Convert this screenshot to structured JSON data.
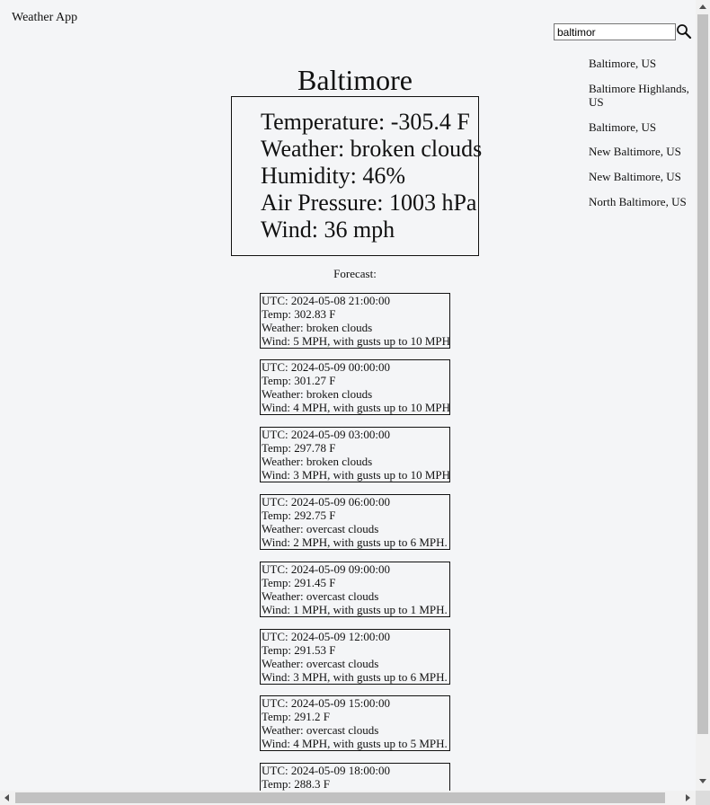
{
  "app": {
    "title": "Weather App"
  },
  "search": {
    "value": "baltimor",
    "icon": "search-icon"
  },
  "suggestions": [
    "Baltimore, US",
    "Baltimore Highlands, US",
    "Baltimore, US",
    "New Baltimore, US",
    "New Baltimore, US",
    "North Baltimore, US"
  ],
  "current": {
    "city": "Baltimore",
    "temperature": "Temperature: -305.4 F",
    "weather": "Weather: broken clouds",
    "humidity": "Humidity: 46%",
    "pressure": "Air Pressure: 1003 hPa",
    "wind": "Wind: 36 mph"
  },
  "forecast": {
    "label": "Forecast:",
    "items": [
      {
        "time": "UTC: 2024-05-08 21:00:00",
        "temp": "Temp: 302.83 F",
        "weather": "Weather: broken clouds",
        "wind": "Wind: 5 MPH, with gusts up to 10 MPH."
      },
      {
        "time": "UTC: 2024-05-09 00:00:00",
        "temp": "Temp: 301.27 F",
        "weather": "Weather: broken clouds",
        "wind": "Wind: 4 MPH, with gusts up to 10 MPH."
      },
      {
        "time": "UTC: 2024-05-09 03:00:00",
        "temp": "Temp: 297.78 F",
        "weather": "Weather: broken clouds",
        "wind": "Wind: 3 MPH, with gusts up to 10 MPH."
      },
      {
        "time": "UTC: 2024-05-09 06:00:00",
        "temp": "Temp: 292.75 F",
        "weather": "Weather: overcast clouds",
        "wind": "Wind: 2 MPH, with gusts up to 6 MPH."
      },
      {
        "time": "UTC: 2024-05-09 09:00:00",
        "temp": "Temp: 291.45 F",
        "weather": "Weather: overcast clouds",
        "wind": "Wind: 1 MPH, with gusts up to 1 MPH."
      },
      {
        "time": "UTC: 2024-05-09 12:00:00",
        "temp": "Temp: 291.53 F",
        "weather": "Weather: overcast clouds",
        "wind": "Wind: 3 MPH, with gusts up to 6 MPH."
      },
      {
        "time": "UTC: 2024-05-09 15:00:00",
        "temp": "Temp: 291.2 F",
        "weather": "Weather: overcast clouds",
        "wind": "Wind: 4 MPH, with gusts up to 5 MPH."
      },
      {
        "time": "UTC: 2024-05-09 18:00:00",
        "temp": "Temp: 288.3 F",
        "weather": "",
        "wind": ""
      }
    ]
  }
}
